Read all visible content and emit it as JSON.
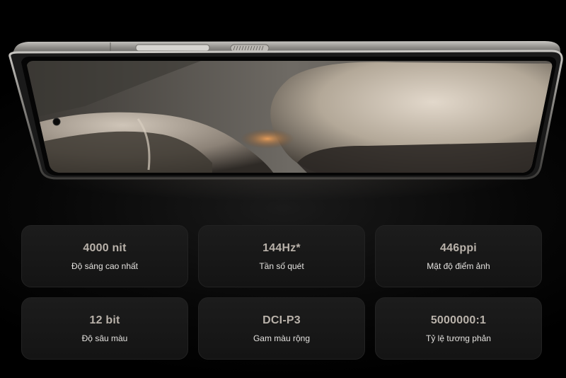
{
  "specs": [
    {
      "value": "4000 nit",
      "label": "Độ sáng cao nhất"
    },
    {
      "value": "144Hz*",
      "label": "Tần số quét"
    },
    {
      "value": "446ppi",
      "label": "Mật độ điểm ảnh"
    },
    {
      "value": "12 bit",
      "label": "Độ sâu màu"
    },
    {
      "value": "DCI-P3",
      "label": "Gam màu rộng"
    },
    {
      "value": "5000000:1",
      "label": "Tỷ lệ tương phản"
    }
  ],
  "colors": {
    "background": "#000000",
    "card": "#181818",
    "value_text": "#b9b2aa",
    "label_text": "#e4e2df",
    "frame": "#8a8884"
  }
}
